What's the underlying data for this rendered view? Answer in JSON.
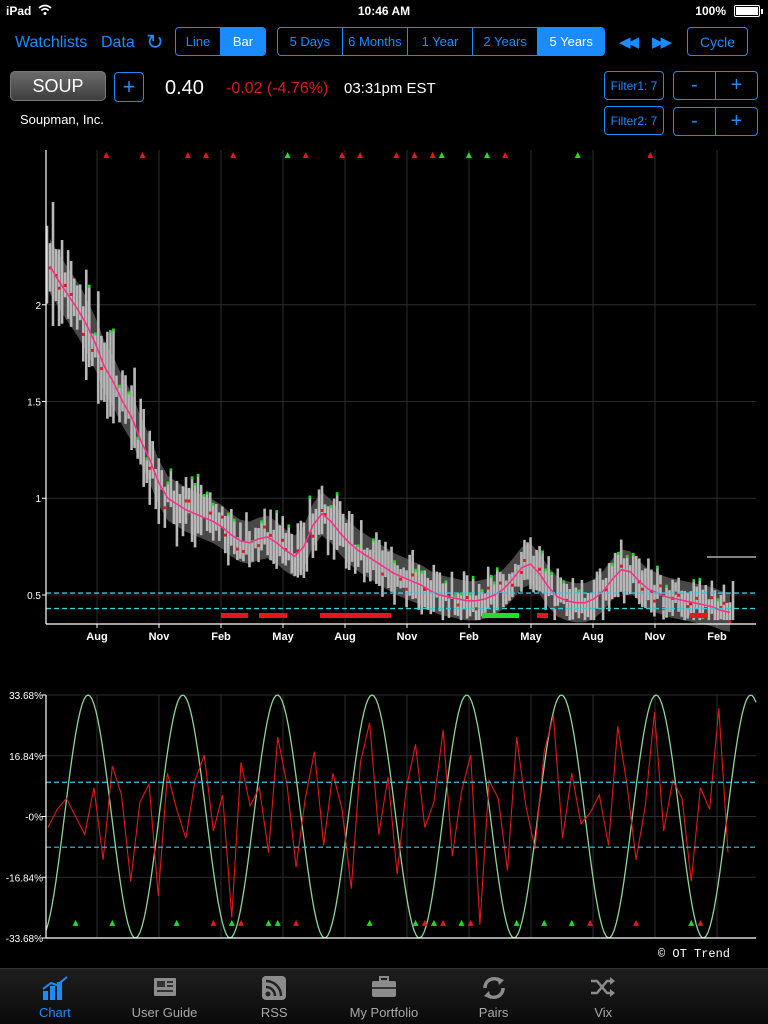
{
  "status_bar": {
    "carrier": "iPad",
    "time": "10:46 AM",
    "battery": "100%",
    "battery_level": 1.0
  },
  "toolbar": {
    "watchlists": "Watchlists",
    "data": "Data",
    "chart_types": [
      "Line",
      "Bar"
    ],
    "chart_type_selected": "Bar",
    "ranges": [
      "5 Days",
      "6 Months",
      "1 Year",
      "2 Years",
      "5 Years"
    ],
    "range_selected": "5 Years",
    "cycle": "Cycle"
  },
  "quote": {
    "symbol": "SOUP",
    "add": "+",
    "price": "0.40",
    "change": "-0.02 (-4.76%)",
    "time": "03:31pm EST",
    "company": "Soupman, Inc."
  },
  "filters": {
    "filter1": "Filter1: 7",
    "filter2": "Filter2: 7",
    "minus": "-",
    "plus": "+"
  },
  "colors": {
    "accent": "#1a8cff",
    "down": "#e0191b",
    "up": "#22dd22",
    "smooth": "#ff2d8a",
    "band": "#555555",
    "cyan": "#33ccdd"
  },
  "chart_data": [
    {
      "type": "bar",
      "title": "",
      "x_ticks": [
        "Aug",
        "Nov",
        "Feb",
        "May",
        "Aug",
        "Nov",
        "Feb",
        "May",
        "Aug",
        "Nov",
        "Feb"
      ],
      "y_ticks": [
        "2",
        "1.5",
        "1",
        "0.5"
      ],
      "ylim": [
        0.35,
        2.8
      ],
      "reference_lines": [
        0.51,
        0.43
      ],
      "series": [
        {
          "name": "",
          "values": [
            2.2,
            2.12,
            2.05,
            1.98,
            1.9,
            1.8,
            1.68,
            1.6,
            1.5,
            1.42,
            1.3,
            1.2,
            1.08,
            1.0,
            0.97,
            0.94,
            0.92,
            0.9,
            0.88,
            0.85,
            0.81,
            0.78,
            0.77,
            0.79,
            0.8,
            0.77,
            0.73,
            0.7,
            0.75,
            0.86,
            0.92,
            0.88,
            0.82,
            0.77,
            0.73,
            0.7,
            0.67,
            0.64,
            0.61,
            0.59,
            0.57,
            0.55,
            0.52,
            0.5,
            0.49,
            0.48,
            0.47,
            0.47,
            0.48,
            0.5,
            0.53,
            0.58,
            0.64,
            0.66,
            0.61,
            0.54,
            0.49,
            0.47,
            0.46,
            0.46,
            0.48,
            0.52,
            0.58,
            0.63,
            0.62,
            0.57,
            0.53,
            0.51,
            0.49,
            0.48,
            0.47,
            0.46,
            0.45,
            0.44,
            0.42,
            0.41
          ]
        }
      ],
      "signal_markers_top": [
        {
          "i": 4,
          "dir": "down"
        },
        {
          "i": 8,
          "dir": "down"
        },
        {
          "i": 13,
          "dir": "down"
        },
        {
          "i": 15,
          "dir": "down"
        },
        {
          "i": 18,
          "dir": "down"
        },
        {
          "i": 24,
          "dir": "up"
        },
        {
          "i": 26,
          "dir": "down"
        },
        {
          "i": 30,
          "dir": "down"
        },
        {
          "i": 32,
          "dir": "down"
        },
        {
          "i": 36,
          "dir": "down"
        },
        {
          "i": 38,
          "dir": "down"
        },
        {
          "i": 40,
          "dir": "down"
        },
        {
          "i": 41,
          "dir": "up"
        },
        {
          "i": 44,
          "dir": "up"
        },
        {
          "i": 46,
          "dir": "up"
        },
        {
          "i": 48,
          "dir": "down"
        },
        {
          "i": 56,
          "dir": "up"
        },
        {
          "i": 64,
          "dir": "down"
        }
      ]
    },
    {
      "type": "line",
      "title": "",
      "y_ticks": [
        "33.68%",
        "16.84%",
        "-0%",
        "-16.84%",
        "-33.68%"
      ],
      "ylim": [
        -33.68,
        33.68
      ],
      "reference_lines": [
        9.5,
        -8.5
      ],
      "series": [
        {
          "name": "",
          "color": "green",
          "cycles": 7.5,
          "amplitude": 33.68
        },
        {
          "name": "",
          "color": "red",
          "values": [
            -3,
            2,
            5,
            0,
            -5,
            8,
            -12,
            14,
            6,
            -18,
            4,
            9,
            -22,
            12,
            2,
            -6,
            10,
            17,
            -4,
            6,
            -28,
            15,
            3,
            8,
            -10,
            22,
            9,
            -14,
            5,
            18,
            -8,
            12,
            2,
            -20,
            15,
            26,
            -5,
            11,
            -16,
            8,
            20,
            -3,
            4,
            24,
            -11,
            7,
            17,
            -30,
            10,
            5,
            -15,
            22,
            3,
            -9,
            18,
            28,
            -6,
            12,
            -2,
            1,
            6,
            -8,
            25,
            9,
            -12,
            3,
            29,
            -4,
            10,
            5,
            -18,
            8,
            2,
            30,
            -10
          ]
        }
      ],
      "signal_markers": [
        {
          "i": 3,
          "dir": "up"
        },
        {
          "i": 7,
          "dir": "up"
        },
        {
          "i": 14,
          "dir": "up"
        },
        {
          "i": 18,
          "dir": "down"
        },
        {
          "i": 20,
          "dir": "up"
        },
        {
          "i": 21,
          "dir": "down"
        },
        {
          "i": 24,
          "dir": "up"
        },
        {
          "i": 25,
          "dir": "up"
        },
        {
          "i": 27,
          "dir": "down"
        },
        {
          "i": 35,
          "dir": "up"
        },
        {
          "i": 40,
          "dir": "up"
        },
        {
          "i": 41,
          "dir": "down"
        },
        {
          "i": 42,
          "dir": "up"
        },
        {
          "i": 43,
          "dir": "down"
        },
        {
          "i": 45,
          "dir": "up"
        },
        {
          "i": 46,
          "dir": "down"
        },
        {
          "i": 51,
          "dir": "up"
        },
        {
          "i": 54,
          "dir": "up"
        },
        {
          "i": 57,
          "dir": "up"
        },
        {
          "i": 59,
          "dir": "down"
        },
        {
          "i": 64,
          "dir": "down"
        },
        {
          "i": 70,
          "dir": "up"
        },
        {
          "i": 71,
          "dir": "down"
        }
      ]
    }
  ],
  "copyright": "© OT Trend",
  "tabs": [
    {
      "label": "Chart",
      "icon": "chart-icon"
    },
    {
      "label": "User Guide",
      "icon": "newspaper-icon"
    },
    {
      "label": "RSS",
      "icon": "rss-icon"
    },
    {
      "label": "My Portfolio",
      "icon": "briefcase-icon"
    },
    {
      "label": "Pairs",
      "icon": "arrows-cycle-icon"
    },
    {
      "label": "Vix",
      "icon": "shuffle-icon"
    }
  ]
}
